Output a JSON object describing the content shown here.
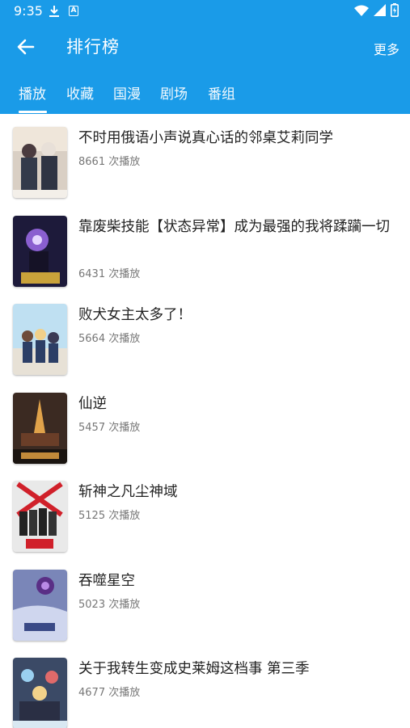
{
  "status_bar": {
    "time": "9:35",
    "a_icon": "A"
  },
  "toolbar": {
    "title": "排行榜",
    "more_label": "更多"
  },
  "tabs": [
    {
      "label": "播放",
      "selected": true
    },
    {
      "label": "收藏",
      "selected": false
    },
    {
      "label": "国漫",
      "selected": false
    },
    {
      "label": "剧场",
      "selected": false
    },
    {
      "label": "番组",
      "selected": false
    }
  ],
  "items": [
    {
      "title": "不时用俄语小声说真心话的邻桌艾莉同学",
      "plays": "8661 次播放"
    },
    {
      "title": "靠废柴技能【状态异常】成为最强的我将蹂躏一切",
      "plays": "6431 次播放"
    },
    {
      "title": "败犬女主太多了！",
      "plays": "5664 次播放"
    },
    {
      "title": "仙逆",
      "plays": "5457 次播放"
    },
    {
      "title": "斩神之凡尘神域",
      "plays": "5125 次播放"
    },
    {
      "title": "吞噬星空",
      "plays": "5023 次播放"
    },
    {
      "title": "关于我转生变成史莱姆这档事 第三季",
      "plays": "4677 次播放"
    }
  ],
  "colors": {
    "accent": "#1a9be8",
    "title_text": "#222222",
    "meta_text": "#777777"
  },
  "icons": [
    "download-icon",
    "a-icon",
    "wifi-icon",
    "cell-signal-icon",
    "battery-icon",
    "back-arrow-icon"
  ]
}
